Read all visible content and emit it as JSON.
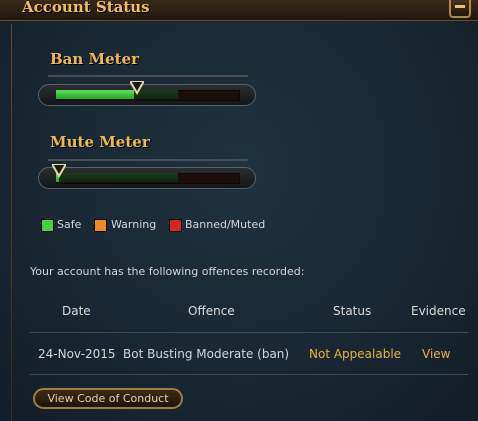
{
  "header": {
    "title": "Account Status"
  },
  "ban_meter": {
    "label": "Ban Meter",
    "level": 0.43
  },
  "mute_meter": {
    "label": "Mute Meter",
    "level": 0.0
  },
  "legend": [
    {
      "label": "Safe",
      "color": "#3fd23f"
    },
    {
      "label": "Warning",
      "color": "#f08a1c"
    },
    {
      "label": "Banned/Muted",
      "color": "#d42323"
    }
  ],
  "offences": {
    "intro": "Your account has the following offences recorded:",
    "columns": [
      "Date",
      "Offence",
      "Status",
      "Evidence"
    ],
    "rows": [
      {
        "date": "24-Nov-2015",
        "offence": "Bot Busting Moderate (ban)",
        "status": "Not Appealable",
        "evidence": "View"
      }
    ]
  },
  "footer": {
    "conduct_button": "View Code of Conduct"
  }
}
